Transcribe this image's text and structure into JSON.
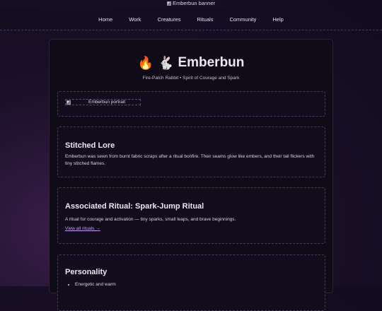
{
  "banner": {
    "alt": "Emberbun banner"
  },
  "nav": {
    "items": [
      "Home",
      "Work",
      "Creatures",
      "Rituals",
      "Community",
      "Help"
    ]
  },
  "header": {
    "emoji_fire": "🔥",
    "emoji_rabbit": "🐇",
    "title": "Emberbun",
    "subtitle": "Fire-Patch Rabbit • Spirit of Courage and Spark"
  },
  "portrait": {
    "alt": "Emberbun portrait"
  },
  "lore": {
    "title": "Stitched Lore",
    "text": "Emberbun was sewn from burnt fabric scraps after a ritual bonfire. Their seams glow like embers, and their tail flickers with tiny stitched flames."
  },
  "ritual": {
    "title": "Associated Ritual: Spark-Jump Ritual",
    "text": "A ritual for courage and activation — tiny sparks, small leaps, and brave beginnings.",
    "link": "View all rituals →"
  },
  "personality": {
    "title": "Personality",
    "traits": [
      "Energetic and warm"
    ]
  }
}
